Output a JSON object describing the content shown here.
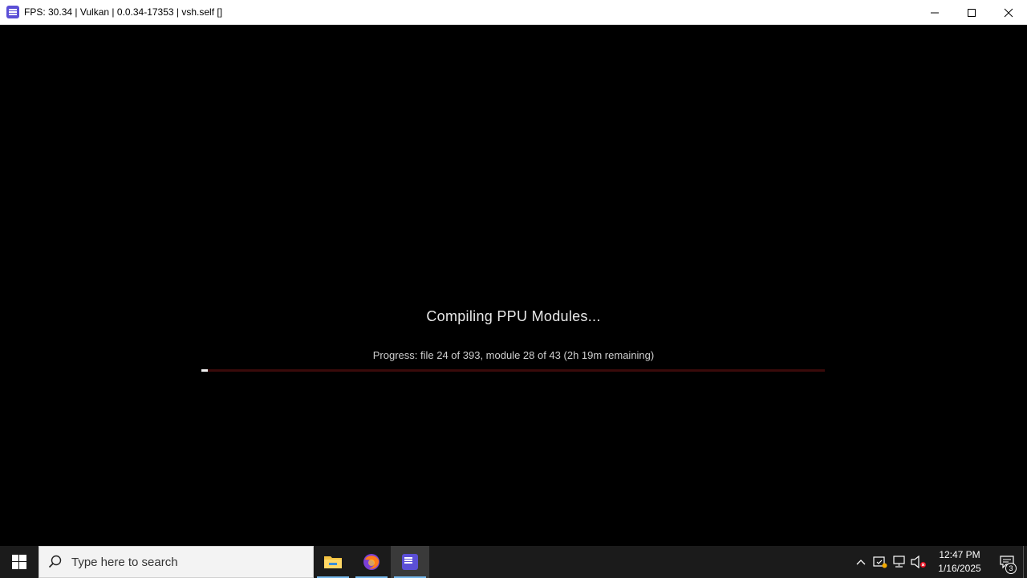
{
  "window": {
    "title": "FPS: 30.34 | Vulkan | 0.0.34-17353 | vsh.self []",
    "icon": "rpcs3-icon"
  },
  "screen": {
    "heading": "Compiling PPU Modules...",
    "progress_text": "Progress: file 24 of 393, module 28 of 43 (2h 19m remaining)",
    "progress_fraction": 0.01
  },
  "taskbar": {
    "search_placeholder": "Type here to search",
    "apps": [
      "file-explorer-icon",
      "firefox-icon",
      "rpcs3-icon"
    ],
    "clock_time": "12:47 PM",
    "clock_date": "1/16/2025",
    "notification_count": "3"
  },
  "colors": {
    "accent": "#76b9ed",
    "progress_track": "#3a0a0a",
    "progress_fill": "#f2f2f2"
  }
}
